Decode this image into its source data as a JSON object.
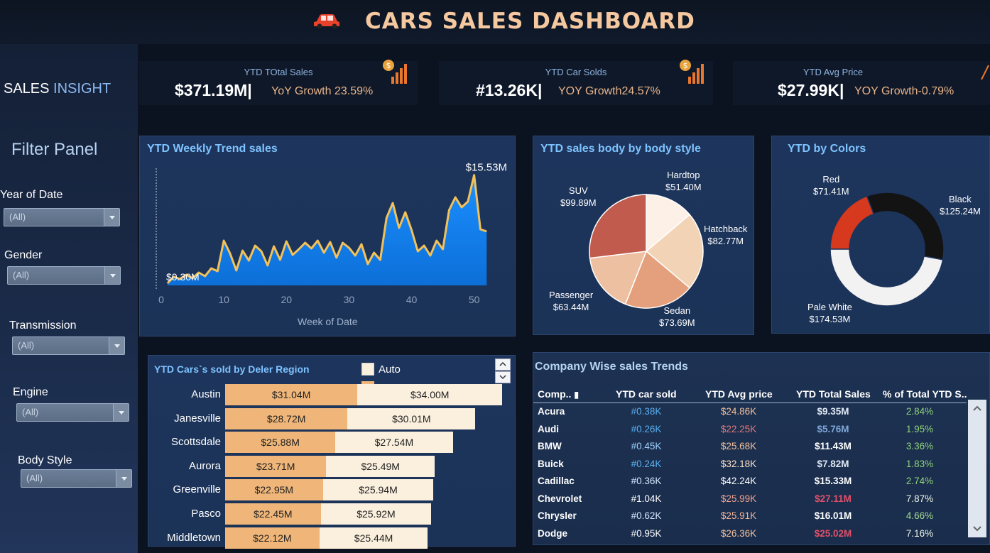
{
  "header": {
    "title": "CARS SALES DASHBOARD",
    "icon": "car-icon"
  },
  "sidebar": {
    "brand_a": "SALES",
    "brand_b": "INSIGHT",
    "filter_title": "Filter Panel",
    "filters": [
      {
        "label": "Year of Date",
        "value": "(All)"
      },
      {
        "label": "Gender",
        "value": "(All)"
      },
      {
        "label": "Transmission",
        "value": "(All)"
      },
      {
        "label": "Engine",
        "value": "(All)"
      },
      {
        "label": "Body Style",
        "value": "(All)"
      }
    ]
  },
  "kpis": [
    {
      "title": "YTD TOtal Sales",
      "value": "$371.19M|",
      "growth": "YoY Growth 23.59%"
    },
    {
      "title": "YTD Car Solds",
      "value": "#13.26K|",
      "growth": "YOY Growth24.57%"
    },
    {
      "title": "YTD Avg Price",
      "value": "$27.99K|",
      "growth": "YOY Growth-0.79%"
    }
  ],
  "weekly": {
    "title": "YTD Weekly Trend sales",
    "max_label": "$15.53M",
    "min_label": "$0.30M",
    "xlabel": "Week of Date",
    "xticks": [
      "0",
      "10",
      "20",
      "30",
      "40",
      "50"
    ],
    "chart_data": {
      "type": "area",
      "x": [
        1,
        2,
        3,
        4,
        5,
        6,
        7,
        8,
        9,
        10,
        11,
        12,
        13,
        14,
        15,
        16,
        17,
        18,
        19,
        20,
        21,
        22,
        23,
        24,
        25,
        26,
        27,
        28,
        29,
        30,
        31,
        32,
        33,
        34,
        35,
        36,
        37,
        38,
        39,
        40,
        41,
        42,
        43,
        44,
        45,
        46,
        47,
        48,
        49,
        50,
        51,
        52
      ],
      "y": [
        0.3,
        1.2,
        0.9,
        1.5,
        1.0,
        1.8,
        1.3,
        2.4,
        2.0,
        6.3,
        4.5,
        2.1,
        4.9,
        3.5,
        5.6,
        4.8,
        2.8,
        5.5,
        3.6,
        6.2,
        4.3,
        5.1,
        6.0,
        5.2,
        6.3,
        4.6,
        6.1,
        3.9,
        6.0,
        5.3,
        4.2,
        5.8,
        3.0,
        4.6,
        3.6,
        9.5,
        11.6,
        8.1,
        10.3,
        7.8,
        4.8,
        5.6,
        4.2,
        6.3,
        5.1,
        10.6,
        12.4,
        11.0,
        11.8,
        15.53,
        7.9,
        7.6
      ],
      "ylim": [
        0,
        16
      ]
    }
  },
  "body_style": {
    "title": "YTD sales body by body style",
    "chart_data": {
      "type": "pie",
      "categories": [
        "Hardtop",
        "Hatchback",
        "Sedan",
        "Passenger",
        "SUV"
      ],
      "values": [
        51.4,
        82.77,
        73.69,
        63.44,
        99.89
      ],
      "labels": [
        "$51.40M",
        "$82.77M",
        "$73.69M",
        "$63.44M",
        "$99.89M"
      ],
      "colors": [
        "#fdf0e6",
        "#f3d3b6",
        "#e4a07c",
        "#eec0a2",
        "#c15b4e"
      ]
    }
  },
  "colors": {
    "title": "YTD by Colors",
    "chart_data": {
      "type": "pie",
      "categories": [
        "Red",
        "Black",
        "Pale White"
      ],
      "values": [
        71.41,
        125.24,
        174.53
      ],
      "labels": [
        "$71.41M",
        "$125.24M",
        "$174.53M"
      ],
      "colors": [
        "#d6391e",
        "#131313",
        "#f2f2f2"
      ]
    }
  },
  "regions": {
    "title": "YTD Cars`s sold by Deler Region",
    "legend_auto": "Auto",
    "chart_data": {
      "type": "bar",
      "categories": [
        "Austin",
        "Janesville",
        "Scottsdale",
        "Aurora",
        "Greenville",
        "Pasco",
        "Middletown"
      ],
      "series": [
        {
          "name": "Auto",
          "values": [
            31.04,
            28.72,
            25.88,
            23.71,
            22.95,
            22.45,
            22.12
          ],
          "labels": [
            "$31.04M",
            "$28.72M",
            "$25.88M",
            "$23.71M",
            "$22.95M",
            "$22.45M",
            "$22.12M"
          ]
        },
        {
          "values": [
            34.0,
            30.01,
            27.54,
            25.49,
            25.94,
            25.92,
            25.44
          ],
          "labels": [
            "$34.00M",
            "$30.01M",
            "$27.54M",
            "$25.49M",
            "$25.94M",
            "$25.92M",
            "$25.44M"
          ]
        }
      ]
    }
  },
  "company": {
    "title": "Company Wise sales Trends",
    "headers": [
      "Comp..",
      "YTD car sold",
      "YTD Avg price",
      "YTD Total Sales",
      "% of Total YTD S.."
    ],
    "rows": [
      [
        "Acura",
        "#0.38K",
        "$24.86K",
        "$9.35M",
        "2.84%"
      ],
      [
        "Audi",
        "#0.26K",
        "$22.25K",
        "$5.76M",
        "1.95%"
      ],
      [
        "BMW",
        "#0.45K",
        "$25.68K",
        "$11.43M",
        "3.36%"
      ],
      [
        "Buick",
        "#0.24K",
        "$32.18K",
        "$7.82M",
        "1.83%"
      ],
      [
        "Cadillac",
        "#0.36K",
        "$42.24K",
        "$15.33M",
        "2.74%"
      ],
      [
        "Chevrolet",
        "#1.04K",
        "$25.99K",
        "$27.11M",
        "7.87%"
      ],
      [
        "Chrysler",
        "#0.62K",
        "$25.91K",
        "$16.01M",
        "4.66%"
      ],
      [
        "Dodge",
        "#0.95K",
        "$26.36K",
        "$25.02M",
        "7.16%"
      ]
    ],
    "sold_colors": [
      "#5ab0f0",
      "#5ab0f0",
      "#9fd2ff",
      "#5ab0f0",
      "#d6e8ff",
      "#ffffff",
      "#d6e8ff",
      "#ffffff"
    ],
    "avg_colors": [
      "#f2c19b",
      "#e07a7a",
      "#f2c19b",
      "#ffe0c8",
      "#ffffff",
      "#f2a08c",
      "#f2b49b",
      "#f2c19b"
    ],
    "total_colors": [
      "#dfe8f2",
      "#7ea6d8",
      "#ffffff",
      "#dfe8f2",
      "#ffffff",
      "#e0506a",
      "#ffffff",
      "#e0506a"
    ],
    "pct_colors": [
      "#8fd47a",
      "#8fd47a",
      "#8fd47a",
      "#8fd47a",
      "#8fd47a",
      "#eef7e8",
      "#a9dc94",
      "#eef7e8"
    ]
  }
}
